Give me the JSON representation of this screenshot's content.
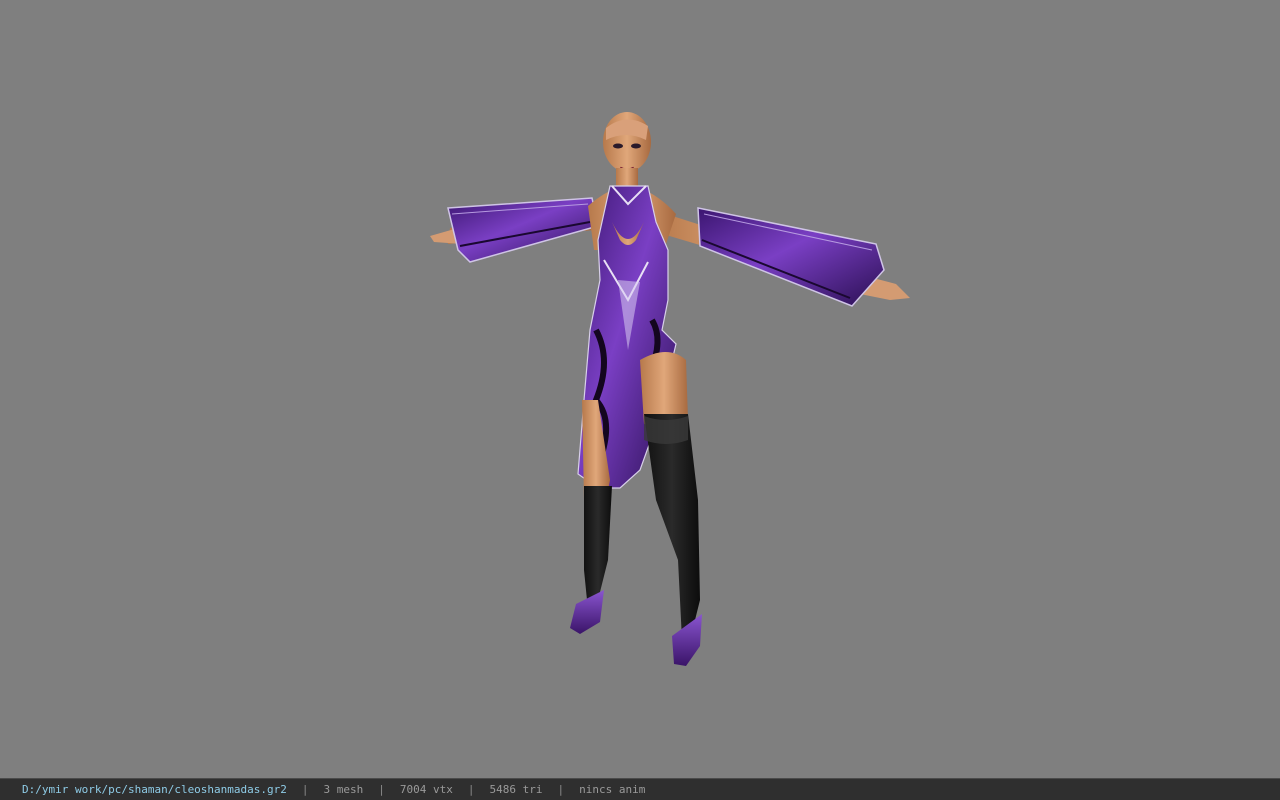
{
  "viewer": {
    "background_color": "#7f7f7f",
    "model_icon": "character-model-icon",
    "outfit_color": "#5b2a9a"
  },
  "status": {
    "file_path": "D:/ymir work/pc/shaman/cleoshanmadas.gr2",
    "separator": "|",
    "mesh_count": "3 mesh",
    "vertex_count": "7004 vtx",
    "triangle_count": "5486 tri",
    "anim": "nincs anim",
    "path_color": "#8ecbe6"
  }
}
